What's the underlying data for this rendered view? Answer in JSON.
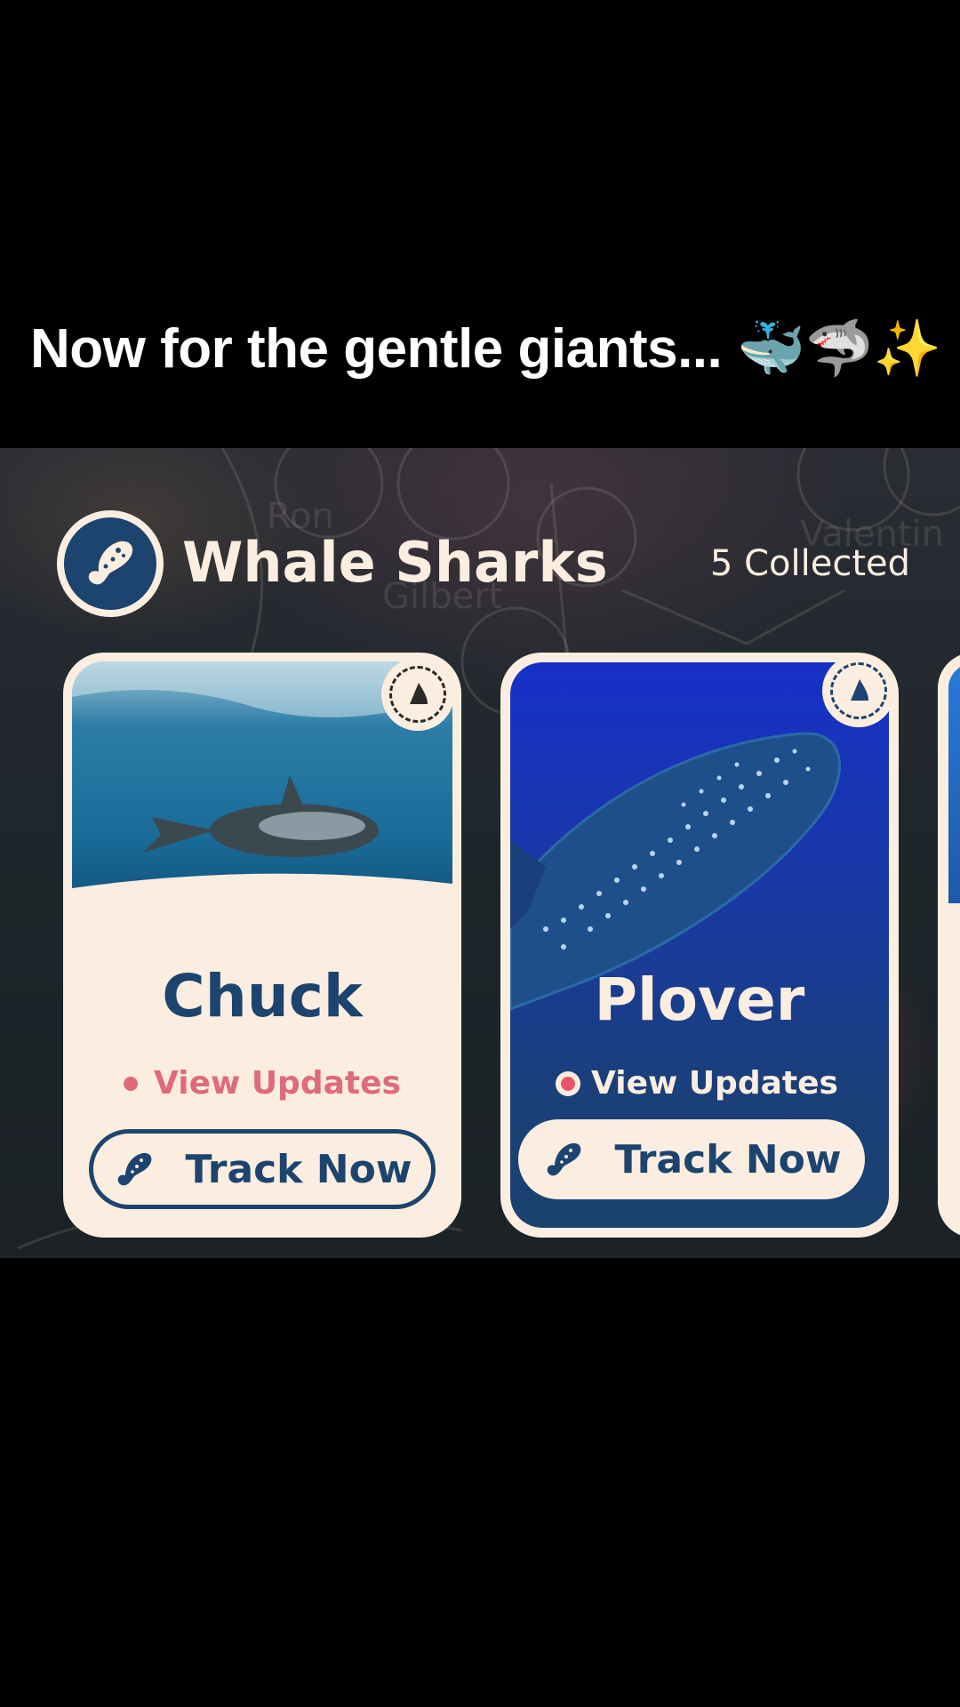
{
  "caption": {
    "text": "Now for the gentle giants... 🐳🦈✨"
  },
  "header": {
    "title": "Whale Sharks",
    "collected": "5 Collected",
    "logo_icon": "whale-shark-icon"
  },
  "cards": [
    {
      "name": "Chuck",
      "updates_label": "View Updates",
      "track_label": "Track Now",
      "badge_icon": "shark-fin-badge-icon",
      "theme": "light"
    },
    {
      "name": "Plover",
      "updates_label": "View Updates",
      "track_label": "Track Now",
      "badge_icon": "shark-fin-badge-icon",
      "theme": "dark"
    }
  ],
  "colors": {
    "navy": "#1d446e",
    "cream": "#fbeee0",
    "accent_pink": "#df6a78",
    "card2_blue": "#1830c8"
  }
}
